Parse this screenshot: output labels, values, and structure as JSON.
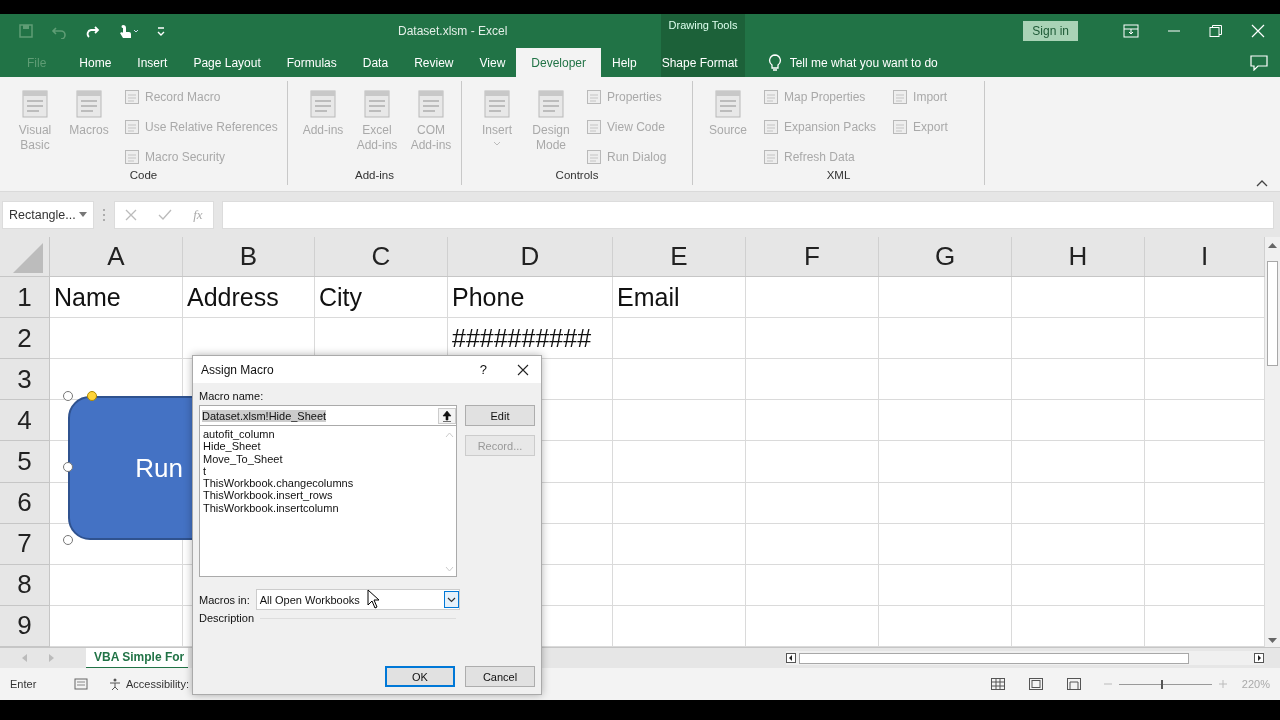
{
  "window": {
    "title": "Dataset.xlsm - Excel",
    "context_label": "Drawing Tools",
    "sign_in": "Sign in"
  },
  "tabs": [
    {
      "label": "File",
      "selected": false,
      "kind": "file"
    },
    {
      "label": "Home",
      "selected": false,
      "kind": "normal"
    },
    {
      "label": "Insert",
      "selected": false,
      "kind": "normal"
    },
    {
      "label": "Page Layout",
      "selected": false,
      "kind": "normal"
    },
    {
      "label": "Formulas",
      "selected": false,
      "kind": "normal"
    },
    {
      "label": "Data",
      "selected": false,
      "kind": "normal"
    },
    {
      "label": "Review",
      "selected": false,
      "kind": "normal"
    },
    {
      "label": "View",
      "selected": false,
      "kind": "normal"
    },
    {
      "label": "Developer",
      "selected": true,
      "kind": "normal"
    },
    {
      "label": "Help",
      "selected": false,
      "kind": "normal"
    },
    {
      "label": "Shape Format",
      "selected": false,
      "kind": "contextual"
    }
  ],
  "tell_me": "Tell me what you want to do",
  "ribbon": {
    "groups": [
      {
        "label": "Code",
        "items": [
          {
            "label": "Visual Basic",
            "kind": "large",
            "disabled": true
          },
          {
            "label": "Macros",
            "kind": "large",
            "disabled": true
          },
          {
            "label": "Record Macro",
            "kind": "small",
            "disabled": true
          },
          {
            "label": "Use Relative References",
            "kind": "small",
            "disabled": true
          },
          {
            "label": "Macro Security",
            "kind": "small",
            "disabled": true
          }
        ]
      },
      {
        "label": "Add-ins",
        "items": [
          {
            "label": "Add-ins",
            "kind": "large",
            "disabled": true
          },
          {
            "label": "Excel Add-ins",
            "kind": "large",
            "disabled": true
          },
          {
            "label": "COM Add-ins",
            "kind": "large",
            "disabled": true
          }
        ]
      },
      {
        "label": "Controls",
        "items": [
          {
            "label": "Insert",
            "kind": "large",
            "disabled": true,
            "has_menu": true
          },
          {
            "label": "Design Mode",
            "kind": "large",
            "disabled": true
          },
          {
            "label": "Properties",
            "kind": "small",
            "disabled": true
          },
          {
            "label": "View Code",
            "kind": "small",
            "disabled": true
          },
          {
            "label": "Run Dialog",
            "kind": "small",
            "disabled": true
          }
        ]
      },
      {
        "label": "XML",
        "items": [
          {
            "label": "Source",
            "kind": "large",
            "disabled": true
          },
          {
            "label": "Map Properties",
            "kind": "small",
            "disabled": true
          },
          {
            "label": "Expansion Packs",
            "kind": "small",
            "disabled": true
          },
          {
            "label": "Refresh Data",
            "kind": "small",
            "disabled": true
          },
          {
            "label": "Import",
            "kind": "small",
            "disabled": true
          },
          {
            "label": "Export",
            "kind": "small",
            "disabled": true
          }
        ]
      }
    ]
  },
  "formula_bar": {
    "name_box": "Rectangle...",
    "function_label": "fx"
  },
  "sheet": {
    "columns": [
      "A",
      "B",
      "C",
      "D",
      "E",
      "F",
      "G",
      "H",
      "I"
    ],
    "rows": [
      {
        "number": "1",
        "cells": [
          "Name",
          "Address",
          "City",
          "Phone",
          "Email"
        ]
      },
      {
        "number": "2",
        "cells": [
          null,
          null,
          null,
          "##########"
        ]
      },
      {
        "number": "3",
        "cells": []
      },
      {
        "number": "4",
        "cells": []
      },
      {
        "number": "5",
        "cells": []
      },
      {
        "number": "6",
        "cells": []
      },
      {
        "number": "7",
        "cells": []
      },
      {
        "number": "8",
        "cells": []
      },
      {
        "number": "9",
        "cells": []
      }
    ]
  },
  "shape": {
    "text": "Run",
    "selected": true
  },
  "sheet_tabs": [
    {
      "label": "VBA Simple For",
      "selected": true
    }
  ],
  "status_bar": {
    "mode": "Enter",
    "accessibility": "Accessibility:",
    "zoom": "220%",
    "zoom_slider": {
      "level": 0.46
    }
  },
  "dialog": {
    "title": "Assign Macro",
    "help": "?",
    "macro_name_label": "Macro name:",
    "macro_name": "Dataset.xlsm!Hide_Sheet",
    "macros": [
      {
        "name": "autofit_column",
        "selected": false
      },
      {
        "name": "Hide_Sheet",
        "selected": false
      },
      {
        "name": "Move_To_Sheet",
        "selected": false
      },
      {
        "name": "t",
        "selected": false
      },
      {
        "name": "ThisWorkbook.changecolumns",
        "selected": false
      },
      {
        "name": "ThisWorkbook.insert_rows",
        "selected": false
      },
      {
        "name": "ThisWorkbook.insertcolumn",
        "selected": false
      }
    ],
    "buttons": [
      {
        "label": "Edit",
        "disabled": false
      },
      {
        "label": "Record...",
        "disabled": true
      }
    ],
    "macros_in_label": "Macros in:",
    "macros_in": "All Open Workbooks",
    "description_label": "Description",
    "footer_buttons": [
      {
        "label": "OK",
        "default": true
      },
      {
        "label": "Cancel",
        "default": false
      }
    ]
  }
}
